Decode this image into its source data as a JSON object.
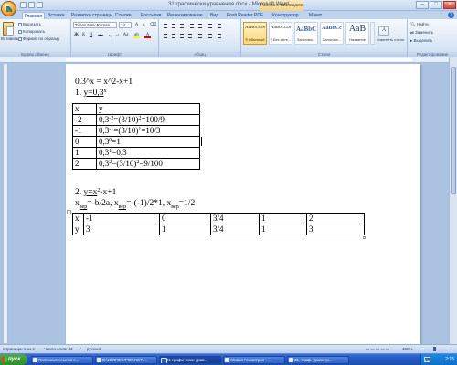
{
  "window": {
    "title": "31 графически уравнения.docx - Microsoft Word",
    "context_tab": "Работа с таблицами",
    "controls": [
      "–",
      "□",
      "×"
    ]
  },
  "tabs": [
    "Главная",
    "Вставка",
    "Разметка страницы",
    "Ссылки",
    "Рассылки",
    "Рецензирование",
    "Вид",
    "Foxit Reader PDF",
    "Конструктор",
    "Макет"
  ],
  "ribbon": {
    "clipboard": {
      "paste": "Вставить",
      "cut": "Вырезать",
      "copy": "Копировать",
      "format_painter": "Формат по образцу",
      "group_label": "Буфер обмена"
    },
    "font": {
      "name": "Times New Roman",
      "size": "14",
      "bold": "Ж",
      "italic": "К",
      "underline": "Ч",
      "strike": "abe",
      "subscript": "x₂",
      "superscript": "x²",
      "case": "Aa",
      "group_label": "Шрифт"
    },
    "paragraph": {
      "group_label": "Абзац"
    },
    "styles": {
      "items": [
        {
          "sample": "AaBbCcDc",
          "name": "¶ Обычный"
        },
        {
          "sample": "AaBbCcDc",
          "name": "¶ Без инте..."
        },
        {
          "sample": "AaBbC",
          "name": "Заголово..."
        },
        {
          "sample": "AaBbCc",
          "name": "Заголово..."
        },
        {
          "sample": "AaB",
          "name": "Название"
        }
      ],
      "change_styles": "Изменить стили",
      "group_label": "Стили"
    },
    "editing": {
      "find": "Найти",
      "replace": "Заменить",
      "select": "Выделить",
      "group_label": "Редактирование"
    }
  },
  "document": {
    "line1": "0.3^x = x^2-x+1",
    "item1": {
      "num": "1. ",
      "text": "y=0,3",
      "sup": "x"
    },
    "table1": {
      "header": [
        "x",
        "y"
      ],
      "rows": [
        {
          "x": "-2",
          "y_parts": [
            "0,3",
            "-2",
            "=(3/10)",
            "2",
            "=100/9"
          ]
        },
        {
          "x": "-1",
          "y_parts": [
            "0,3",
            "-1",
            "=(3/10)",
            "1",
            "=10/3"
          ]
        },
        {
          "x": "0",
          "y_parts": [
            "0,3",
            "0",
            "=1",
            "",
            ""
          ]
        },
        {
          "x": "1",
          "y_parts": [
            "0,3",
            "1",
            "=0,3",
            "",
            ""
          ]
        },
        {
          "x": "2",
          "y_parts": [
            "0,3",
            "2",
            "=(3/10)",
            "2",
            "=9/100"
          ]
        }
      ]
    },
    "item2": {
      "num": "2. ",
      "text_a": "y=x",
      "sup": "2",
      "text_b": "-x+1"
    },
    "vertex_line": {
      "a": "x",
      "a_sub": "вер",
      "b": "=-b/2a,   ",
      "c": "x",
      "c_sub": "вер",
      "d": "=-(-1)/2*1,   x",
      "e_sub": "вер",
      "f": "=1/2"
    },
    "table2": {
      "x_row": [
        "x",
        "-1",
        "0",
        "3/4",
        "1",
        "2"
      ],
      "y_row": [
        "y",
        "3",
        "1",
        "3/4",
        "1",
        "3"
      ]
    }
  },
  "status_bar": {
    "page": "Страница: 1 из 2",
    "words": "Число слов: 43",
    "language": "русский",
    "zoom": "150%"
  },
  "taskbar": {
    "start": "пуск",
    "tasks": [
      "Полезные ссылки с...",
      "D:\\ИНФОКУРОК.НЕТ\\...",
      "31 графически урав...",
      "Живая Геометрия - ...",
      "31. граф. уравн гр..."
    ],
    "lang": "RU",
    "time": "2:15"
  }
}
